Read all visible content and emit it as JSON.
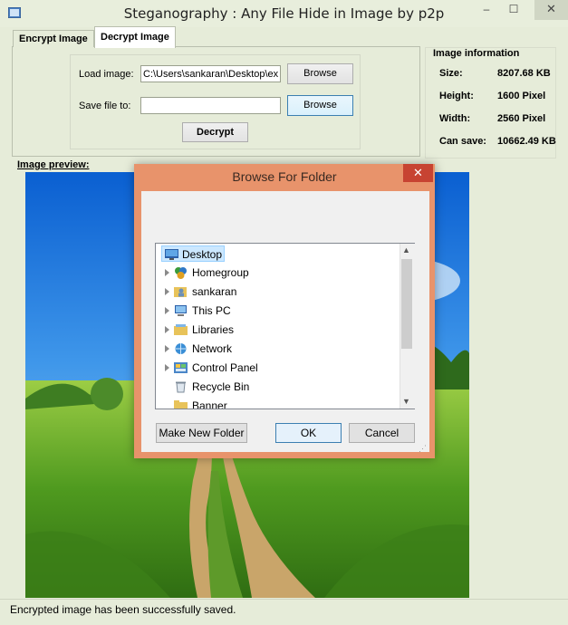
{
  "window": {
    "title": "Steganography : Any File Hide in Image by p2p",
    "minimize": "–",
    "maximize": "☐",
    "close": "✕"
  },
  "tabs": [
    {
      "label": "Encrypt Image"
    },
    {
      "label": "Decrypt Image"
    }
  ],
  "decrypt": {
    "load_label": "Load image:",
    "load_value": "C:\\Users\\sankaran\\Desktop\\ex",
    "save_label": "Save file to:",
    "save_value": "",
    "browse_label": "Browse",
    "browse2_label": "Browse",
    "decrypt_label": "Decrypt"
  },
  "info": {
    "title": "Image information",
    "rows": [
      {
        "key": "Size:",
        "value": "8207.68 KB"
      },
      {
        "key": "Height:",
        "value": "1600 Pixel"
      },
      {
        "key": "Width:",
        "value": "2560 Pixel"
      },
      {
        "key": "Can save:",
        "value": "10662.49 KB"
      }
    ]
  },
  "preview": {
    "label": "Image preview:"
  },
  "status": {
    "text": "Encrypted image has been successfully saved."
  },
  "dialog": {
    "title": "Browse For Folder",
    "close": "✕",
    "tree": [
      {
        "label": "Desktop",
        "icon": "desktop-icon"
      },
      {
        "label": "Homegroup",
        "icon": "homegroup-icon"
      },
      {
        "label": "sankaran",
        "icon": "user-folder-icon"
      },
      {
        "label": "This PC",
        "icon": "computer-icon"
      },
      {
        "label": "Libraries",
        "icon": "libraries-icon"
      },
      {
        "label": "Network",
        "icon": "network-icon"
      },
      {
        "label": "Control Panel",
        "icon": "control-panel-icon"
      },
      {
        "label": "Recycle Bin",
        "icon": "recycle-bin-icon"
      },
      {
        "label": "Banner",
        "icon": "folder-icon"
      }
    ],
    "make_new_folder": "Make New Folder",
    "ok": "OK",
    "cancel": "Cancel"
  }
}
